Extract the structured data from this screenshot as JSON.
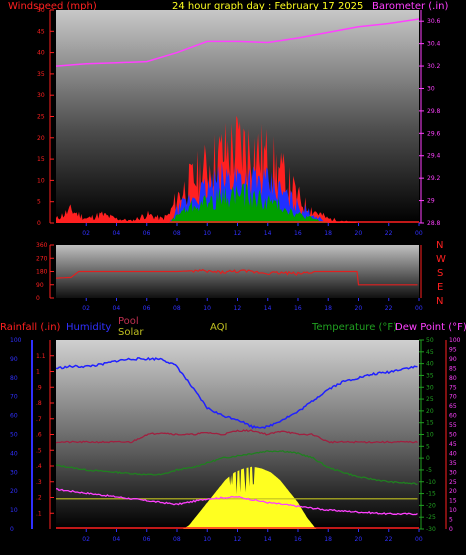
{
  "header": {
    "wind_label": "Windspeed (mph)",
    "title": "24 hour graph day : February 17 2025",
    "baro_label": "Barometer (.in)"
  },
  "panel3_labels": {
    "rain": "Rainfall (.in)",
    "humidity": "Humidity",
    "pool": "Pool",
    "solar": "Solar",
    "aqi": "AQI",
    "temperature": "Temperature (°F)",
    "dewpoint": "Dew Point (°F)"
  },
  "compass": [
    "N",
    "W",
    "S",
    "E",
    "N"
  ],
  "colors": {
    "wind_red": "#ff2020",
    "wind_blue": "#2030ff",
    "wind_green": "#00a000",
    "baro": "#ff40ff",
    "direction": "#e02020",
    "humidity": "#2020ff",
    "pool": "#a02040",
    "solar": "#ffff20",
    "temperature": "#208020",
    "dewpoint": "#ff40ff",
    "aqi": "#c0c020"
  },
  "chart_data": [
    {
      "type": "line",
      "title": "24 hour graph day : February 17 2025",
      "xlabel": "",
      "x_ticks": [
        "02",
        "04",
        "06",
        "08",
        "10",
        "12",
        "14",
        "16",
        "18",
        "20",
        "22",
        "00"
      ],
      "y_left_label": "Windspeed (mph)",
      "y_left_ticks": [
        "0",
        "5",
        "10",
        "15",
        "20",
        "25",
        "30",
        "35",
        "40",
        "45",
        "50"
      ],
      "y_left_range": [
        0,
        50
      ],
      "y_right_label": "Barometer (.in)",
      "y_right_ticks": [
        "28.8",
        "29",
        "29.2",
        "29.4",
        "29.6",
        "29.8",
        "30",
        "30.2",
        "30.4",
        "30.6"
      ],
      "y_right_range": [
        28.8,
        30.7
      ],
      "series": [
        {
          "axis": "right",
          "x": [
            0,
            2,
            4,
            6,
            8,
            10,
            12,
            14,
            16,
            18,
            20,
            22,
            24
          ],
          "values": [
            30.2,
            30.22,
            30.23,
            30.24,
            30.32,
            30.42,
            30.42,
            30.41,
            30.45,
            30.5,
            30.55,
            30.58,
            30.62
          ]
        },
        {
          "axis": "left",
          "x": [
            0,
            1,
            2,
            3,
            4,
            5,
            6,
            7,
            7.5,
            8,
            9,
            10,
            11,
            12,
            13,
            14,
            15,
            16,
            16.5,
            17,
            17.5,
            18,
            19,
            20,
            21,
            22,
            23,
            24
          ],
          "values": [
            1,
            3,
            1,
            2,
            1,
            0.5,
            2,
            1,
            2,
            6,
            10,
            13,
            16,
            18,
            17,
            15,
            11,
            6,
            4,
            3,
            2,
            1,
            0.5,
            0,
            0,
            0,
            0,
            0
          ]
        },
        {
          "axis": "left",
          "x": [
            0,
            7.5,
            8,
            9,
            10,
            11,
            12,
            13,
            14,
            15,
            16,
            17,
            18,
            24
          ],
          "values": [
            0,
            0,
            3,
            6,
            8,
            10,
            11,
            10,
            9,
            7,
            4,
            2,
            0,
            0
          ]
        },
        {
          "axis": "left",
          "x": [
            0,
            7.5,
            8,
            9,
            10,
            11,
            12,
            13,
            14,
            15,
            16,
            17,
            18,
            24
          ],
          "values": [
            0,
            0,
            2,
            4,
            5,
            6,
            7,
            6,
            5,
            4,
            2,
            1,
            0,
            0
          ]
        }
      ]
    },
    {
      "type": "line",
      "x_ticks": [
        "02",
        "04",
        "06",
        "08",
        "10",
        "12",
        "14",
        "16",
        "18",
        "20",
        "22",
        "00"
      ],
      "y_ticks": [
        "0",
        "90",
        "180",
        "270",
        "360"
      ],
      "y_range": [
        0,
        360
      ],
      "series": [
        {
          "x": [
            0,
            1,
            1.5,
            8,
            9,
            10,
            11,
            12,
            13,
            14,
            15,
            16,
            17,
            19.9,
            20,
            24
          ],
          "values": [
            135,
            140,
            180,
            180,
            185,
            180,
            175,
            182,
            178,
            170,
            172,
            165,
            180,
            180,
            90,
            90
          ]
        }
      ]
    },
    {
      "type": "line",
      "x_ticks": [
        "02",
        "04",
        "06",
        "08",
        "10",
        "12",
        "14",
        "16",
        "18",
        "20",
        "22",
        "00"
      ],
      "rain_ticks": [
        ".1",
        ".2",
        ".3",
        ".4",
        ".5",
        ".6",
        ".7",
        ".8",
        ".9",
        "1",
        "1.1"
      ],
      "rain_range": [
        0,
        1.2
      ],
      "humidity_ticks": [
        "0",
        "10",
        "20",
        "30",
        "40",
        "50",
        "60",
        "70",
        "80",
        "90",
        "100"
      ],
      "humidity_range": [
        0,
        100
      ],
      "temperature_ticks": [
        "50",
        "45",
        "40",
        "35",
        "30",
        "25",
        "20",
        "15",
        "10",
        "5",
        "0",
        "-5",
        "-10",
        "-15",
        "-20",
        "-25",
        "-30"
      ],
      "temperature_range": [
        -30,
        50
      ],
      "dewpoint_ticks": [
        "100",
        "95",
        "90",
        "85",
        "80",
        "75",
        "70",
        "65",
        "60",
        "55",
        "50",
        "45",
        "40",
        "35",
        "30",
        "25",
        "20",
        "15",
        "10",
        "5",
        "0"
      ],
      "dewpoint_range": [
        0,
        100
      ],
      "series": [
        {
          "name": "Humidity",
          "x": [
            0,
            1,
            2,
            3,
            4,
            5,
            6,
            7,
            8,
            9,
            10,
            11,
            12,
            13,
            14,
            15,
            16,
            17,
            18,
            19,
            20,
            21,
            22,
            23,
            24
          ],
          "values": [
            85,
            86,
            86,
            87,
            89,
            90,
            90,
            90,
            86,
            75,
            64,
            60,
            58,
            54,
            54,
            58,
            62,
            68,
            74,
            78,
            80,
            82,
            83,
            85,
            86
          ]
        },
        {
          "name": "Pool",
          "x": [
            0,
            1,
            2,
            3,
            4,
            5,
            6,
            7,
            8,
            9,
            10,
            11,
            12,
            13,
            14,
            15,
            16,
            17,
            18,
            19,
            20,
            21,
            22,
            23,
            24
          ],
          "values": [
            46,
            46,
            46,
            46,
            46,
            46,
            50,
            51,
            50,
            50,
            51,
            50,
            52,
            52,
            50,
            52,
            50,
            50,
            46,
            46,
            46,
            46,
            46,
            46,
            46
          ]
        },
        {
          "name": "Temperature",
          "x": [
            0,
            2,
            4,
            6,
            7,
            8,
            9,
            10,
            11,
            12,
            13,
            14,
            15,
            16,
            17,
            18,
            20,
            22,
            24
          ],
          "values": [
            -3,
            -5,
            -6,
            -7,
            -7,
            -5,
            -4,
            -2,
            0,
            1,
            2,
            3,
            3,
            2,
            0,
            -4,
            -8,
            -10,
            -11
          ]
        },
        {
          "name": "Dew Point",
          "x": [
            0,
            2,
            4,
            6,
            8,
            10,
            12,
            14,
            16,
            18,
            20,
            22,
            24
          ],
          "values": [
            21,
            19,
            17,
            15,
            13,
            16,
            17,
            14,
            12,
            10,
            9,
            8,
            8
          ]
        },
        {
          "name": "Solar",
          "x": [
            0,
            8.4,
            8.8,
            9.4,
            10,
            10.6,
            11.2,
            11.8,
            12.4,
            13,
            13.6,
            14.2,
            14.8,
            15.4,
            16,
            16.6,
            17.2,
            24
          ],
          "values": [
            0,
            0,
            2,
            8,
            14,
            20,
            26,
            30,
            32,
            33,
            32,
            30,
            26,
            20,
            14,
            6,
            0,
            0
          ]
        },
        {
          "name": "AQI",
          "x": [
            0,
            6,
            12,
            18,
            24
          ],
          "values": [
            16,
            16,
            16,
            16,
            16
          ]
        }
      ]
    }
  ]
}
